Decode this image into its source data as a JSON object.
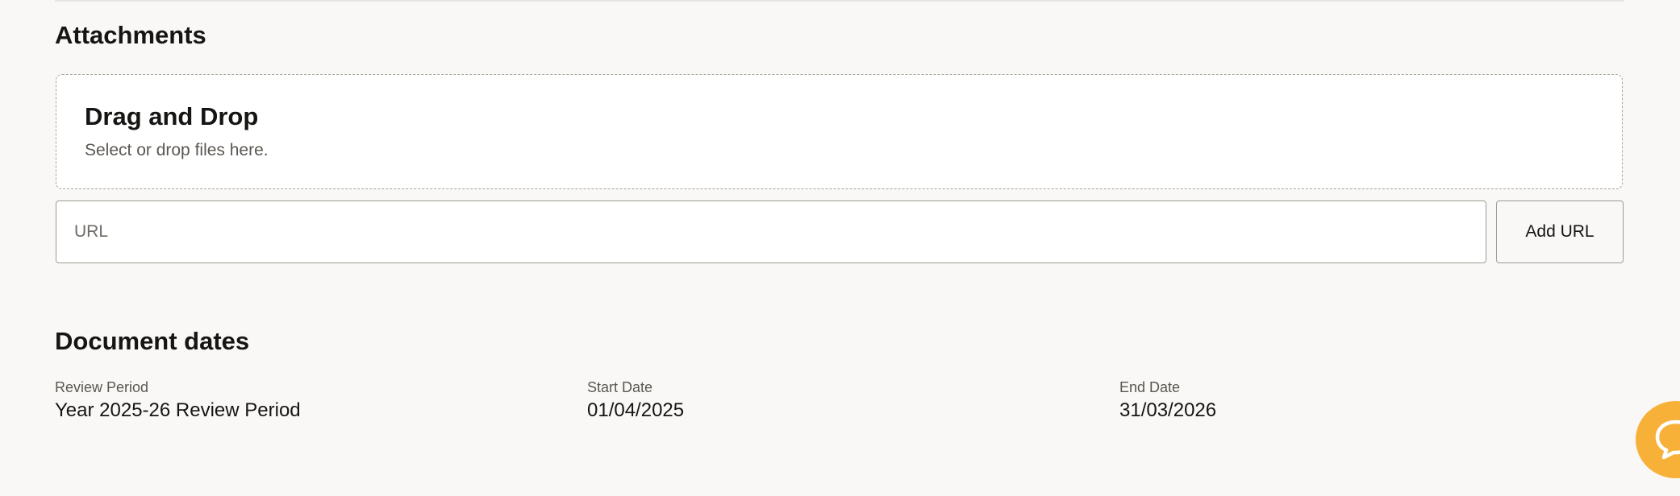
{
  "attachments": {
    "title": "Attachments",
    "dropzone": {
      "title": "Drag and Drop",
      "hint": "Select or drop files here."
    },
    "url_input": {
      "value": "",
      "placeholder": "URL"
    },
    "add_url_label": "Add URL"
  },
  "document_dates": {
    "title": "Document dates",
    "review_period": {
      "label": "Review Period",
      "value": "Year 2025-26 Review Period"
    },
    "start_date": {
      "label": "Start Date",
      "value": "01/04/2025"
    },
    "end_date": {
      "label": "End Date",
      "value": "31/03/2026"
    }
  },
  "chat": {
    "icon": "chat-bubble-icon",
    "color": "#f7b139"
  },
  "colors": {
    "background": "#f9f8f6",
    "text": "#161513",
    "muted_text": "#5b5752",
    "border": "#9e9a94"
  }
}
